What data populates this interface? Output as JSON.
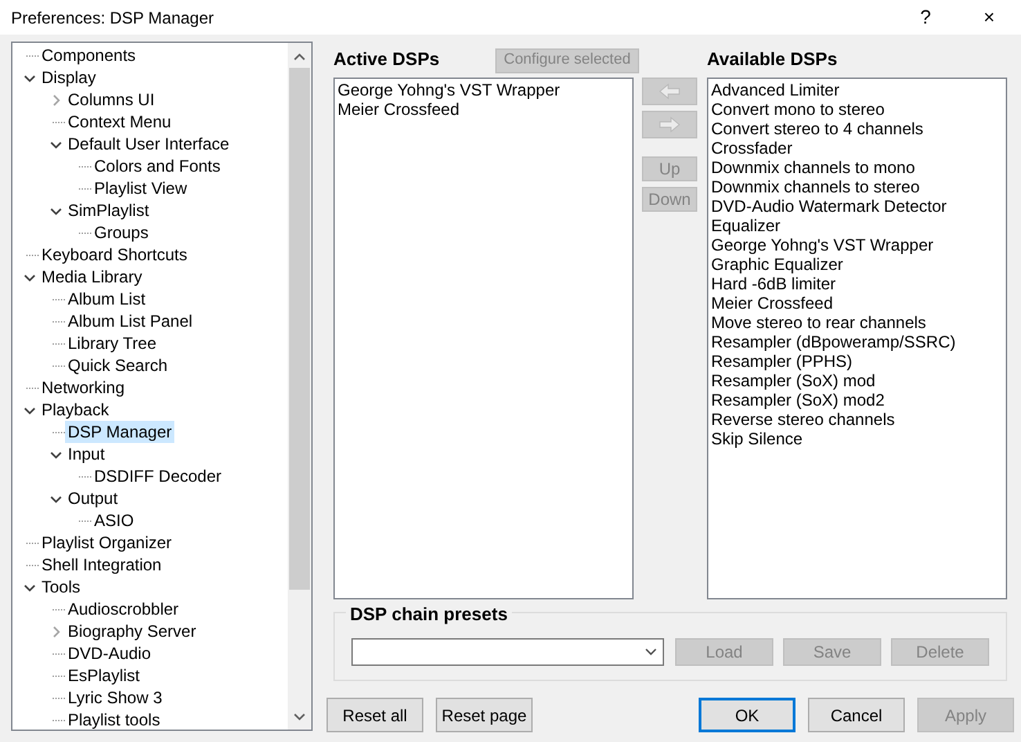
{
  "window": {
    "title": "Preferences: DSP Manager",
    "help": "?",
    "close": "×"
  },
  "tree": [
    {
      "label": "Components",
      "selected": false
    },
    {
      "label": "Display",
      "selected": false,
      "expanded": true,
      "children": [
        {
          "label": "Columns UI",
          "selected": false,
          "expanded": false
        },
        {
          "label": "Context Menu",
          "selected": false
        },
        {
          "label": "Default User Interface",
          "selected": false,
          "expanded": true,
          "children": [
            {
              "label": "Colors and Fonts",
              "selected": false
            },
            {
              "label": "Playlist View",
              "selected": false
            }
          ]
        },
        {
          "label": "SimPlaylist",
          "selected": false,
          "expanded": true,
          "children": [
            {
              "label": "Groups",
              "selected": false
            }
          ]
        }
      ]
    },
    {
      "label": "Keyboard Shortcuts",
      "selected": false
    },
    {
      "label": "Media Library",
      "selected": false,
      "expanded": true,
      "children": [
        {
          "label": "Album List",
          "selected": false
        },
        {
          "label": "Album List Panel",
          "selected": false
        },
        {
          "label": "Library Tree",
          "selected": false
        },
        {
          "label": "Quick Search",
          "selected": false
        }
      ]
    },
    {
      "label": "Networking",
      "selected": false
    },
    {
      "label": "Playback",
      "selected": false,
      "expanded": true,
      "children": [
        {
          "label": "DSP Manager",
          "selected": true
        },
        {
          "label": "Input",
          "selected": false,
          "expanded": true,
          "children": [
            {
              "label": "DSDIFF Decoder",
              "selected": false
            }
          ]
        },
        {
          "label": "Output",
          "selected": false,
          "expanded": true,
          "children": [
            {
              "label": "ASIO",
              "selected": false
            }
          ]
        }
      ]
    },
    {
      "label": "Playlist Organizer",
      "selected": false
    },
    {
      "label": "Shell Integration",
      "selected": false
    },
    {
      "label": "Tools",
      "selected": false,
      "expanded": true,
      "children": [
        {
          "label": "Audioscrobbler",
          "selected": false
        },
        {
          "label": "Biography Server",
          "selected": false,
          "expanded": false
        },
        {
          "label": "DVD-Audio",
          "selected": false
        },
        {
          "label": "EsPlaylist",
          "selected": false
        },
        {
          "label": "Lyric Show 3",
          "selected": false
        },
        {
          "label": "Playlist tools",
          "selected": false
        }
      ]
    }
  ],
  "active": {
    "heading": "Active DSPs",
    "configure": {
      "label": "Configure selected",
      "disabled": true
    },
    "items": [
      "George Yohng's VST Wrapper",
      "Meier Crossfeed"
    ]
  },
  "move_buttons": [
    {
      "kind": "left-arrow",
      "disabled": true
    },
    {
      "kind": "right-arrow",
      "disabled": true
    },
    {
      "kind": "text",
      "label": "Up",
      "disabled": true
    },
    {
      "kind": "text",
      "label": "Down",
      "disabled": true
    }
  ],
  "available": {
    "heading": "Available DSPs",
    "items": [
      "Advanced Limiter",
      "Convert mono to stereo",
      "Convert stereo to 4 channels",
      "Crossfader",
      "Downmix channels to mono",
      "Downmix channels to stereo",
      "DVD-Audio Watermark Detector",
      "Equalizer",
      "George Yohng's VST Wrapper",
      "Graphic Equalizer",
      "Hard -6dB limiter",
      "Meier Crossfeed",
      "Move stereo to rear channels",
      "Resampler (dBpoweramp/SSRC)",
      "Resampler (PPHS)",
      "Resampler (SoX) mod",
      "Resampler (SoX) mod2",
      "Reverse stereo channels",
      "Skip Silence"
    ]
  },
  "presets": {
    "heading": "DSP chain presets",
    "buttons": [
      {
        "label": "Load",
        "disabled": true
      },
      {
        "label": "Save",
        "disabled": true
      },
      {
        "label": "Delete",
        "disabled": true
      }
    ]
  },
  "footer_left": [
    {
      "label": "Reset all",
      "disabled": false,
      "default": false
    },
    {
      "label": "Reset page",
      "disabled": false,
      "default": false
    }
  ],
  "footer_right": [
    {
      "label": "OK",
      "disabled": false,
      "default": true
    },
    {
      "label": "Cancel",
      "disabled": false,
      "default": false
    },
    {
      "label": "Apply",
      "disabled": true,
      "default": false
    }
  ]
}
